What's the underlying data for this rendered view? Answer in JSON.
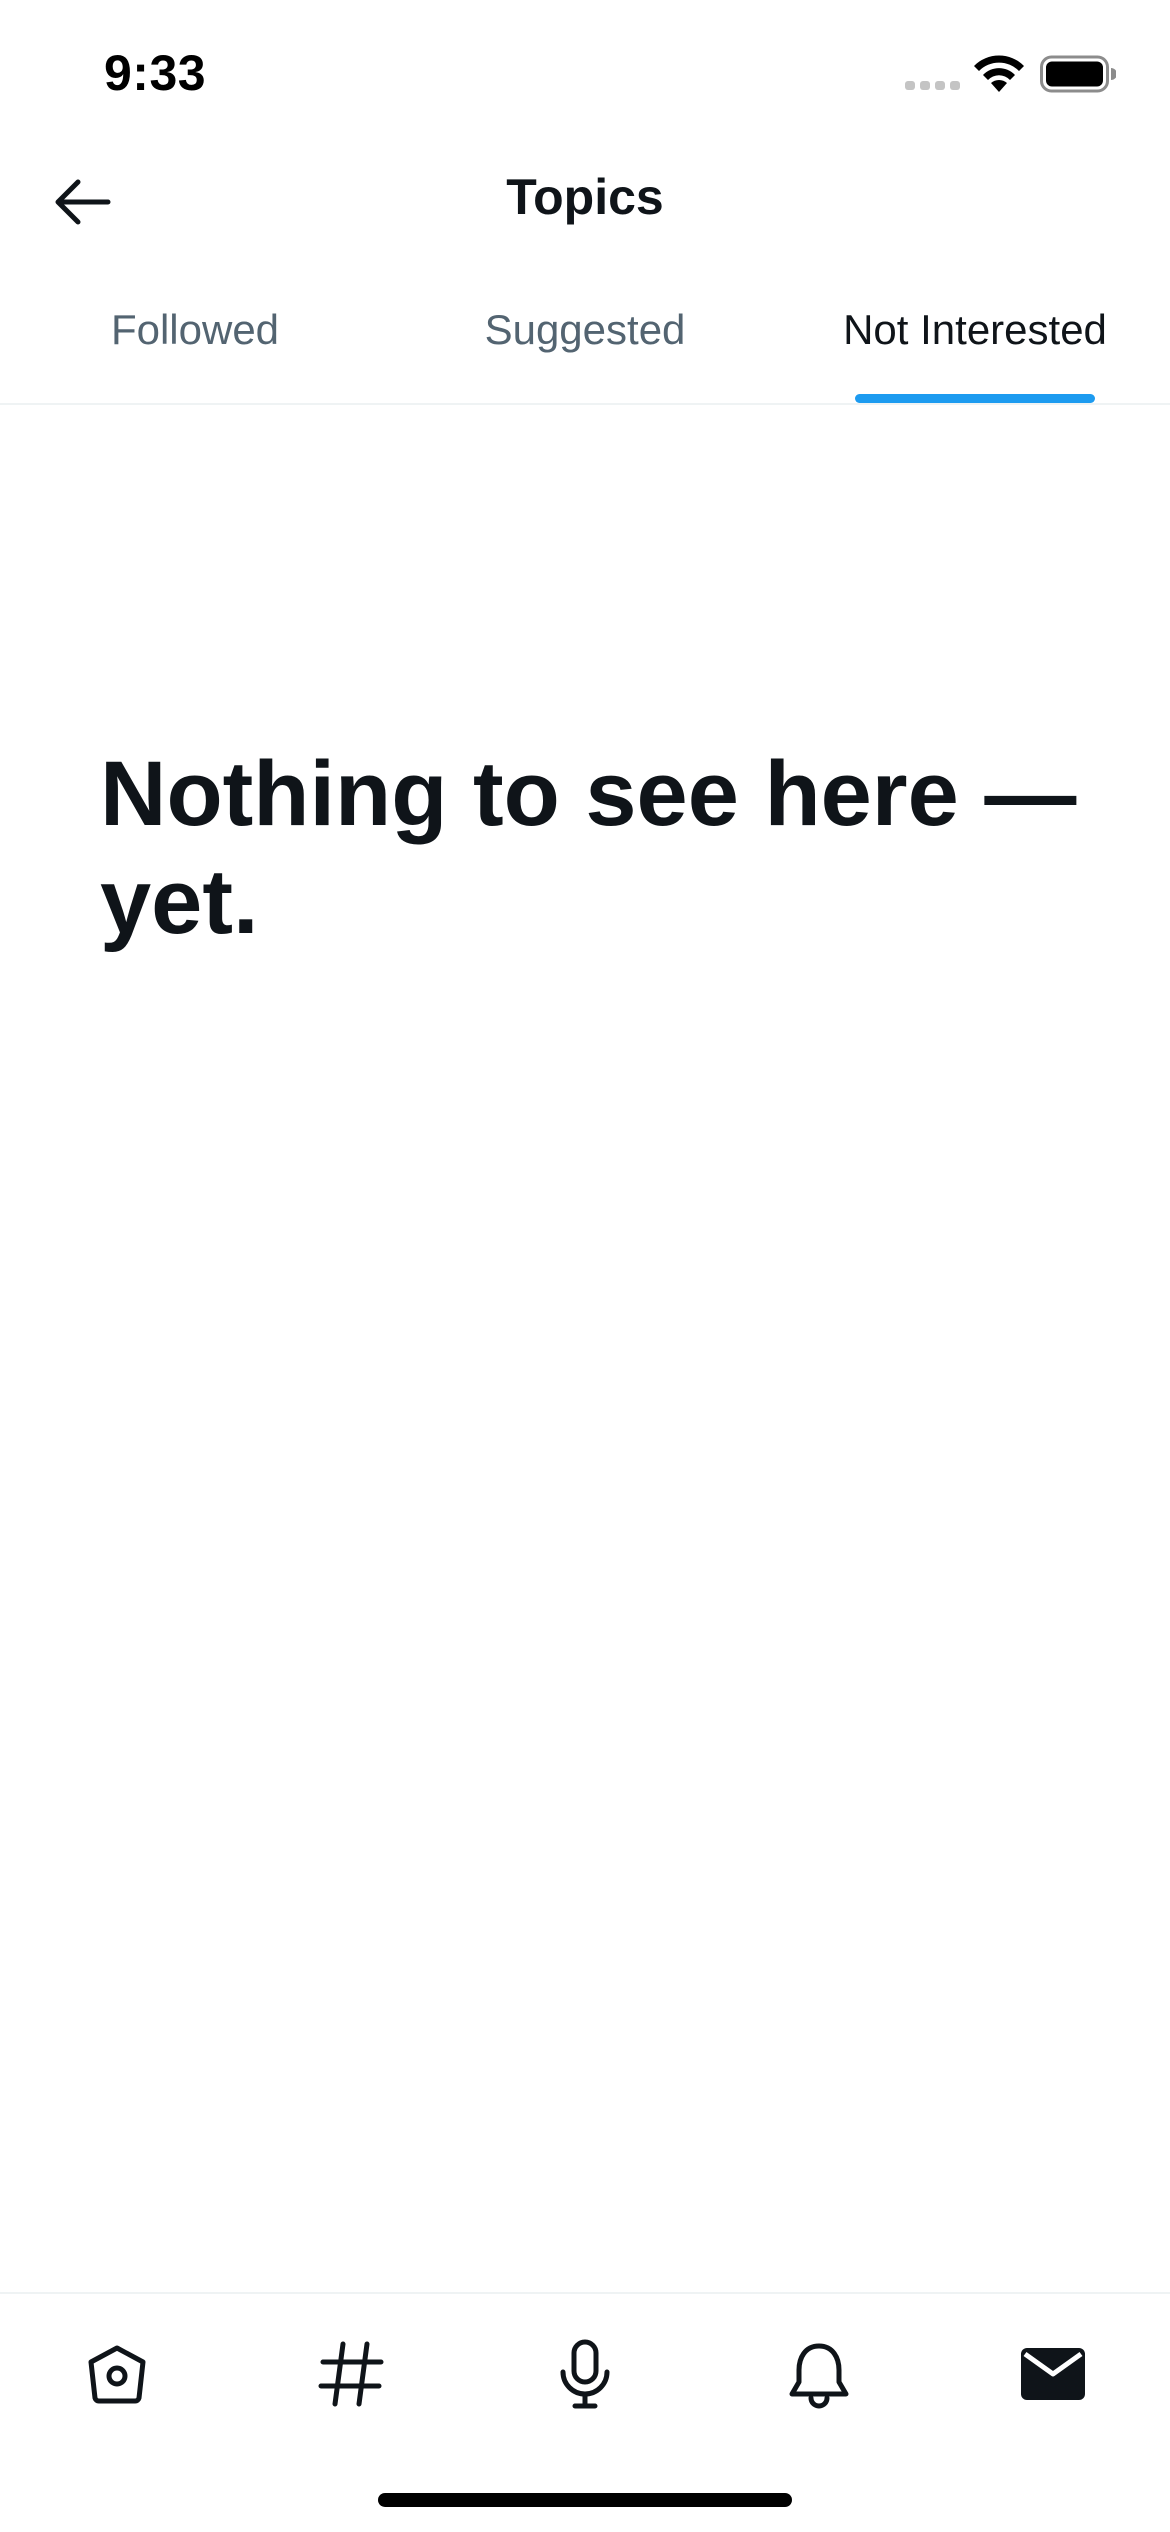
{
  "status_bar": {
    "time": "9:33"
  },
  "header": {
    "title": "Topics",
    "back_icon": "arrow-left-icon"
  },
  "tabs": [
    {
      "label": "Followed",
      "active": false
    },
    {
      "label": "Suggested",
      "active": false
    },
    {
      "label": "Not Interested",
      "active": true
    }
  ],
  "empty_state": {
    "title": "Nothing to see here — yet."
  },
  "bottom_nav": [
    {
      "name": "home",
      "icon": "home-icon",
      "active": false
    },
    {
      "name": "explore",
      "icon": "hashtag-icon",
      "active": false
    },
    {
      "name": "spaces",
      "icon": "microphone-icon",
      "active": false
    },
    {
      "name": "notifications",
      "icon": "bell-icon",
      "active": false
    },
    {
      "name": "messages",
      "icon": "envelope-icon",
      "active": true
    }
  ],
  "colors": {
    "accent": "#1d9bf0",
    "text_primary": "#0f1419",
    "text_secondary": "#536471",
    "divider": "#eff3f4"
  }
}
